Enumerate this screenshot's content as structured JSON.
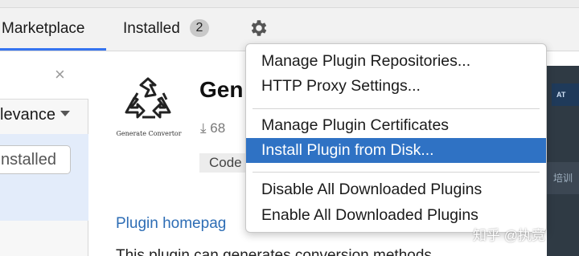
{
  "tabs": {
    "marketplace_label": "Marketplace",
    "installed_label": "Installed",
    "installed_count": "2",
    "active": "Marketplace",
    "accent_color": "#3574f0"
  },
  "left_panel": {
    "clear_icon": "×",
    "sort_label": "Relevance",
    "sort_visible": "levance",
    "installed_button": "Installed",
    "installed_button_visible": "nstalled"
  },
  "plugin": {
    "name": "Generate Convertor",
    "name_visible": "Gen",
    "logo_caption": "Generate Convertor",
    "downloads": "68",
    "tag": "Code",
    "homepage_link": "Plugin homepage",
    "homepage_visible": "Plugin homepag",
    "description_visible": "This plugin can generates conversion methods"
  },
  "menu": {
    "items": [
      {
        "label": "Manage Plugin Repositories..."
      },
      {
        "label": "HTTP Proxy Settings..."
      },
      {
        "label": "Manage Plugin Certificates"
      },
      {
        "label": "Install Plugin from Disk...",
        "highlighted": true
      },
      {
        "label": "Disable All Downloaded Plugins"
      },
      {
        "label": "Enable All Downloaded Plugins"
      }
    ],
    "highlight_color": "#2f72c4"
  },
  "side_strip": {
    "badge_text": "AT",
    "lower_text": "培训"
  },
  "watermark": "知乎 @执竞"
}
